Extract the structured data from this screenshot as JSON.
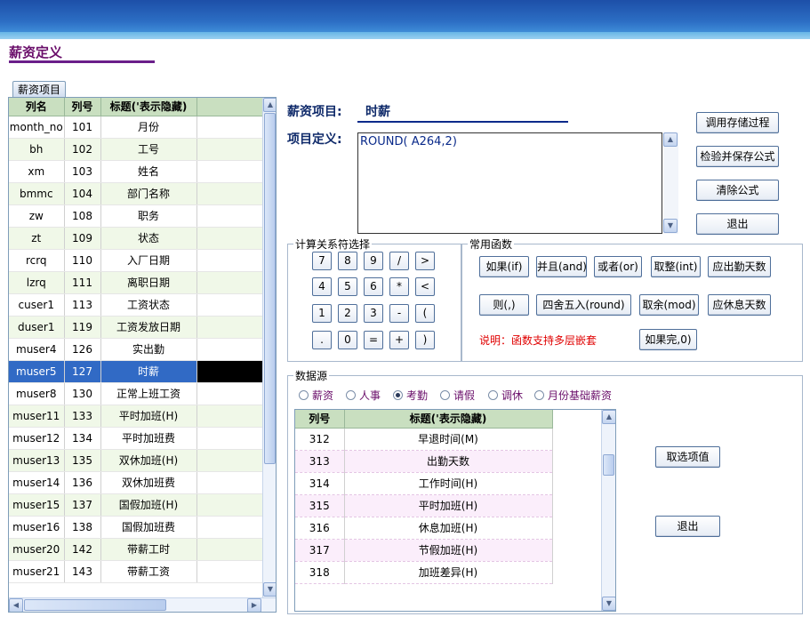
{
  "page_title": "薪资定义",
  "left_tab": "薪资项目",
  "left_table": {
    "headers": [
      "列名",
      "列号",
      "标题('表示隐藏)"
    ],
    "rows": [
      [
        "month_no",
        "101",
        "月份"
      ],
      [
        "bh",
        "102",
        "工号"
      ],
      [
        "xm",
        "103",
        "姓名"
      ],
      [
        "bmmc",
        "104",
        "部门名称"
      ],
      [
        "zw",
        "108",
        "职务"
      ],
      [
        "zt",
        "109",
        "状态"
      ],
      [
        "rcrq",
        "110",
        "入厂日期"
      ],
      [
        "lzrq",
        "111",
        "离职日期"
      ],
      [
        "cuser1",
        "113",
        "工资状态"
      ],
      [
        "duser1",
        "119",
        "工资发放日期"
      ],
      [
        "muser4",
        "126",
        "实出勤"
      ],
      [
        "muser5",
        "127",
        "时薪"
      ],
      [
        "muser8",
        "130",
        "正常上班工资"
      ],
      [
        "muser11",
        "133",
        "平时加班(H)"
      ],
      [
        "muser12",
        "134",
        "平时加班费"
      ],
      [
        "muser13",
        "135",
        "双休加班(H)"
      ],
      [
        "muser14",
        "136",
        "双休加班费"
      ],
      [
        "muser15",
        "137",
        "国假加班(H)"
      ],
      [
        "muser16",
        "138",
        "国假加班费"
      ],
      [
        "muser20",
        "142",
        "带薪工时"
      ],
      [
        "muser21",
        "143",
        "带薪工资"
      ]
    ],
    "selected_index": 11
  },
  "item_label": "薪资项目:",
  "item_value": "时薪",
  "def_label": "项目定义:",
  "formula": "ROUND( A264,2)",
  "right_buttons": [
    "调用存储过程",
    "检验并保存公式",
    "清除公式",
    "退出"
  ],
  "calc_group": {
    "legend": "计算关系符选择",
    "keys": [
      [
        "7",
        "8",
        "9",
        "/",
        ">"
      ],
      [
        "4",
        "5",
        "6",
        "*",
        "<"
      ],
      [
        "1",
        "2",
        "3",
        "-",
        "("
      ],
      [
        ".",
        "0",
        "=",
        "+",
        ")"
      ]
    ]
  },
  "func_group": {
    "legend": "常用函数",
    "row1": [
      "如果(if)",
      "并且(and)",
      "或者(or)",
      "取整(int)",
      "应出勤天数"
    ],
    "row2": [
      "则(,)",
      "四舍五入(round)",
      "取余(mod)",
      "应休息天数"
    ],
    "note": "说明：函数支持多层嵌套",
    "end_button": "如果完,0)"
  },
  "source_group": {
    "legend": "数据源",
    "radios": [
      "薪资",
      "人事",
      "考勤",
      "请假",
      "调休",
      "月份基础薪资"
    ],
    "selected_radio": 2,
    "headers": [
      "列号",
      "标题('表示隐藏)"
    ],
    "rows": [
      [
        "312",
        "早退时间(M)"
      ],
      [
        "313",
        "出勤天数"
      ],
      [
        "314",
        "工作时间(H)"
      ],
      [
        "315",
        "平时加班(H)"
      ],
      [
        "316",
        "休息加班(H)"
      ],
      [
        "317",
        "节假加班(H)"
      ],
      [
        "318",
        "加班差异(H)"
      ]
    ],
    "select_button": "取选项值",
    "exit_button": "退出"
  }
}
